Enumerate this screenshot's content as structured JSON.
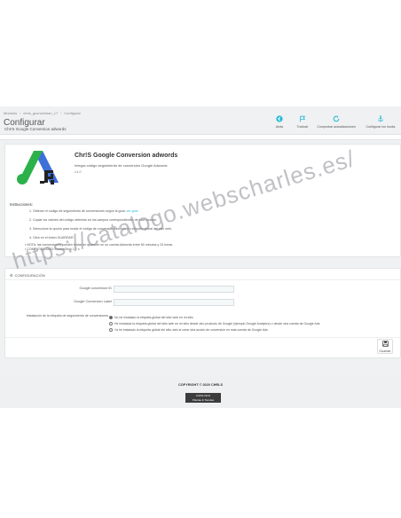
{
  "breadcrumb": [
    "Módulos",
    "chrls_gconversion_17",
    "Configurar"
  ],
  "page": {
    "title": "Configurar",
    "subtitle": "Chr!S Google Conversion adwords"
  },
  "toolbar": [
    {
      "label": "Atrás",
      "icon": "back-icon"
    },
    {
      "label": "Traducir",
      "icon": "flag-icon"
    },
    {
      "label": "Comprobar actualizaciones",
      "icon": "refresh-icon"
    },
    {
      "label": "Configurar los hooks",
      "icon": "anchor-icon"
    }
  ],
  "module": {
    "name": "Chr!S Google Conversion adwords",
    "description": "Integra código seguimiento de conversión Google Adwords",
    "version": "v1.0",
    "colors": {
      "green": "#2db14a",
      "blue": "#3d6fd8",
      "dark": "#222222"
    }
  },
  "instructions": {
    "title": "Instrucciones:",
    "steps": [
      {
        "text": "1. Obtener el código de seguimiento de conversiones según la guía:",
        "link": "ver guía"
      },
      {
        "text": "2. Copiar los valores del código obtenido en los campos correspondientes de este módulo.",
        "link": ""
      },
      {
        "text": "3. Seleccione la opción para incluir el código de conversión adwords y/o etiqueta global del sitio web.",
        "link": ""
      },
      {
        "text": "4. Click en el botón GUARDAR",
        "link": ""
      }
    ],
    "notes": [
      "NOTA: las conversiones pueden tardar en aparecer en su cuenta Adwords entre 60 minutos y 24 horas.",
      "COMPATIBILIDAD: PrestaShop 1.7.x"
    ]
  },
  "config": {
    "heading": "CONFIGURACIÓN",
    "fields": [
      {
        "label": "Google conversion ID",
        "value": ""
      },
      {
        "label": "Google Conversion Label",
        "value": ""
      }
    ],
    "radio_label": "Instalación de la etiqueta de seguimiento de conversiones",
    "radio_options": [
      {
        "text": "No he instalado la etiqueta global del sitio web en mi sitio",
        "checked": true
      },
      {
        "text": "He instalado la etiqueta global del sitio web en mi sitio desde otro producto de Google (ejemplo Google Analytics) o desde otra cuenta de Google Ads",
        "checked": false
      },
      {
        "text": "Ya he instalado la etiqueta global del sitio web al crear otra acción de conversión en esta cuenta de Google Ads",
        "checked": false
      }
    ],
    "save_label": "Guardar"
  },
  "footer": {
    "copyright": "COPYRIGHT © 2020 CHRLS",
    "badge_line1": "CATALOGO",
    "badge_line2": "Plantas & Tiendas"
  },
  "watermark": "https://catalogo.webscharles.es/"
}
